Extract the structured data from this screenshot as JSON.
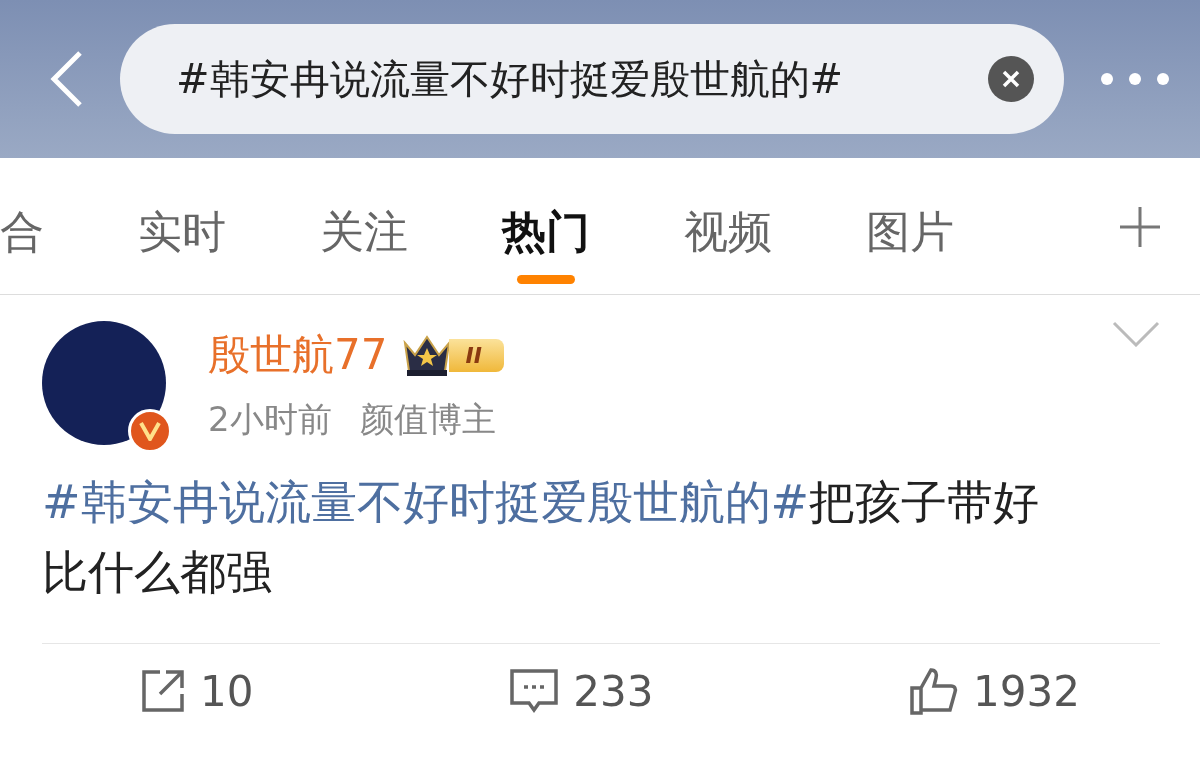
{
  "search": {
    "value": "#韩安冉说流量不好时挺爱殷世航的#"
  },
  "tabs": [
    {
      "label": "合",
      "selected": false
    },
    {
      "label": "实时",
      "selected": false
    },
    {
      "label": "关注",
      "selected": false
    },
    {
      "label": "热门",
      "selected": true
    },
    {
      "label": "视频",
      "selected": false
    },
    {
      "label": "图片",
      "selected": false
    }
  ],
  "post": {
    "author": "殷世航77",
    "verified": true,
    "badge": "II",
    "time": "2小时前",
    "tag": "颜值博主",
    "hashtag": "#韩安冉说流量不好时挺爱殷世航的#",
    "text": "把孩子带好比什么都强",
    "actions": [
      {
        "kind": "repost",
        "count": "10"
      },
      {
        "kind": "comment",
        "count": "233"
      },
      {
        "kind": "like",
        "count": "1932"
      }
    ]
  }
}
